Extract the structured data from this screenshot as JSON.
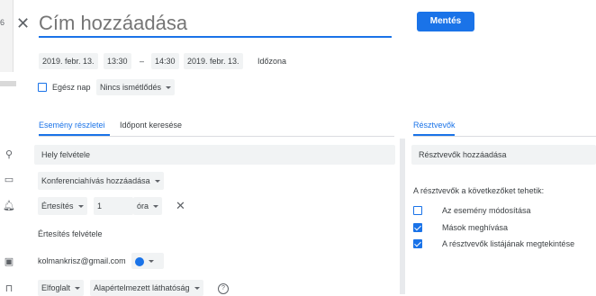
{
  "backdrop": {
    "fragment": "6"
  },
  "header": {
    "close_icon": "close-icon",
    "title_placeholder": "Cím hozzáadása",
    "save_label": "Mentés"
  },
  "datetime": {
    "start_date": "2019. febr. 13.",
    "start_time": "13:30",
    "separator": "–",
    "end_time": "14:30",
    "end_date": "2019. febr. 13.",
    "timezone_label": "Időzona"
  },
  "options": {
    "all_day_label": "Egész nap",
    "all_day_checked": false,
    "repeat_value": "Nincs ismétlődés"
  },
  "tabs": [
    {
      "label": "Esemény részletei",
      "active": true
    },
    {
      "label": "Időpont keresése",
      "active": false
    }
  ],
  "details": {
    "location_placeholder": "Hely felvétele",
    "conference_label": "Konferenciahívás hozzáadása",
    "notification": {
      "type": "Értesítés",
      "amount": "1",
      "unit": "óra"
    },
    "add_notification": "Értesítés felvétele",
    "calendar_owner": "kolmankrisz@gmail.com",
    "calendar_color": "#1a73e8",
    "busy_status": "Elfoglalt",
    "visibility": "Alapértelmezett láthatóság",
    "help_icon": "?"
  },
  "guests": {
    "tab_label": "Résztvevők",
    "add_placeholder": "Résztvevők hozzáadása",
    "permissions_title": "A résztvevők a következőket tehetik:",
    "permissions": [
      {
        "label": "Az esemény módosítása",
        "checked": false
      },
      {
        "label": "Mások meghívása",
        "checked": true
      },
      {
        "label": "A résztvevők listájának megtekintése",
        "checked": true
      }
    ]
  },
  "colors": {
    "accent": "#1a73e8",
    "text": "#3c4043",
    "field_bg": "#f1f3f4"
  }
}
